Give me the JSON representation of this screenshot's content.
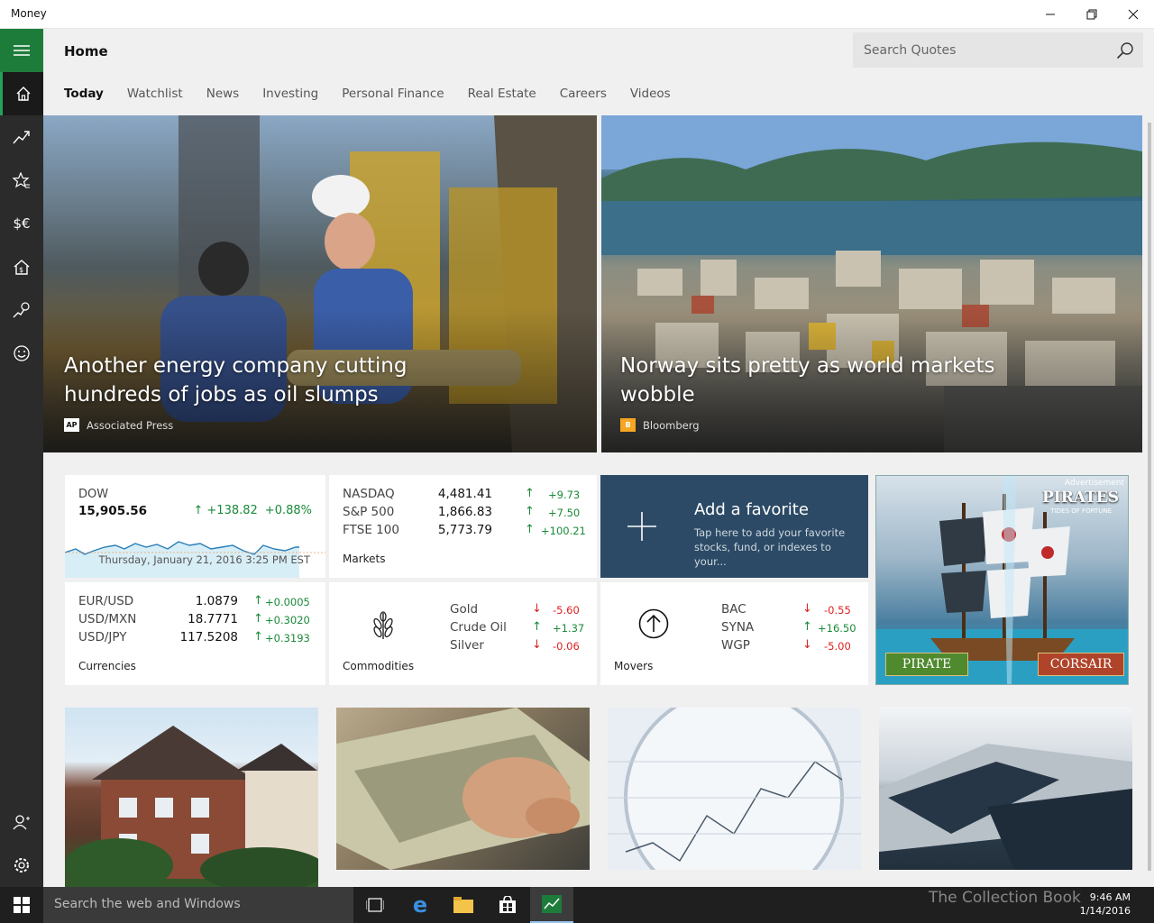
{
  "window": {
    "title": "Money"
  },
  "header": {
    "page_title": "Home",
    "search_placeholder": "Search Quotes"
  },
  "tabs": [
    "Today",
    "Watchlist",
    "News",
    "Investing",
    "Personal Finance",
    "Real Estate",
    "Careers",
    "Videos"
  ],
  "sidebar": {
    "icons": [
      "hamburger-icon",
      "home-icon",
      "markets-icon",
      "watchlist-icon",
      "currencies-icon",
      "real-estate-icon",
      "world-markets-icon",
      "feedback-icon",
      "account-icon",
      "settings-icon"
    ]
  },
  "heroes": [
    {
      "headline": "Another energy company cutting hundreds of jobs as oil slumps",
      "source": "Associated Press",
      "logo": "AP"
    },
    {
      "headline": "Norway sits pretty as world markets wobble",
      "source": "Bloomberg",
      "logo": "B"
    }
  ],
  "dow": {
    "name": "DOW",
    "value": "15,905.56",
    "change": "+138.82",
    "pct": "+0.88%",
    "date": "Thursday, January 21, 2016 3:25 PM EST"
  },
  "markets": {
    "label": "Markets",
    "rows": [
      {
        "name": "NASDAQ",
        "value": "4,481.41",
        "change": "+9.73",
        "dir": "up"
      },
      {
        "name": "S&P 500",
        "value": "1,866.83",
        "change": "+7.50",
        "dir": "up"
      },
      {
        "name": "FTSE 100",
        "value": "5,773.79",
        "change": "+100.21",
        "dir": "up"
      }
    ]
  },
  "favorite": {
    "title": "Add a favorite",
    "subtitle": "Tap here to add your favorite stocks, fund, or indexes to your..."
  },
  "ad": {
    "label": "Advertisement",
    "title": "PIRATES",
    "subtitle": "TIDES OF FORTUNE",
    "left_button": "PIRATE",
    "right_button": "CORSAIR"
  },
  "currencies": {
    "label": "Currencies",
    "rows": [
      {
        "name": "EUR/USD",
        "value": "1.0879",
        "change": "+0.0005",
        "dir": "up"
      },
      {
        "name": "USD/MXN",
        "value": "18.7771",
        "change": "+0.3020",
        "dir": "up"
      },
      {
        "name": "USD/JPY",
        "value": "117.5208",
        "change": "+0.3193",
        "dir": "up"
      }
    ]
  },
  "commodities": {
    "label": "Commodities",
    "rows": [
      {
        "name": "Gold",
        "change": "-5.60",
        "dir": "down"
      },
      {
        "name": "Crude Oil",
        "change": "+1.37",
        "dir": "up"
      },
      {
        "name": "Silver",
        "change": "-0.06",
        "dir": "down"
      }
    ]
  },
  "movers": {
    "label": "Movers",
    "rows": [
      {
        "name": "BAC",
        "change": "-0.55",
        "dir": "down"
      },
      {
        "name": "SYNA",
        "change": "+16.50",
        "dir": "up"
      },
      {
        "name": "WGP",
        "change": "-5.00",
        "dir": "down"
      }
    ]
  },
  "taskbar": {
    "search_placeholder": "Search the web and Windows",
    "time": "9:46 AM",
    "date": "1/14/2016",
    "watermark": "The Collection Book"
  },
  "colors": {
    "accent": "#1e7c3b",
    "up": "#1a8a3a",
    "down": "#dd2222",
    "favorite_tile": "#2c4a65"
  }
}
